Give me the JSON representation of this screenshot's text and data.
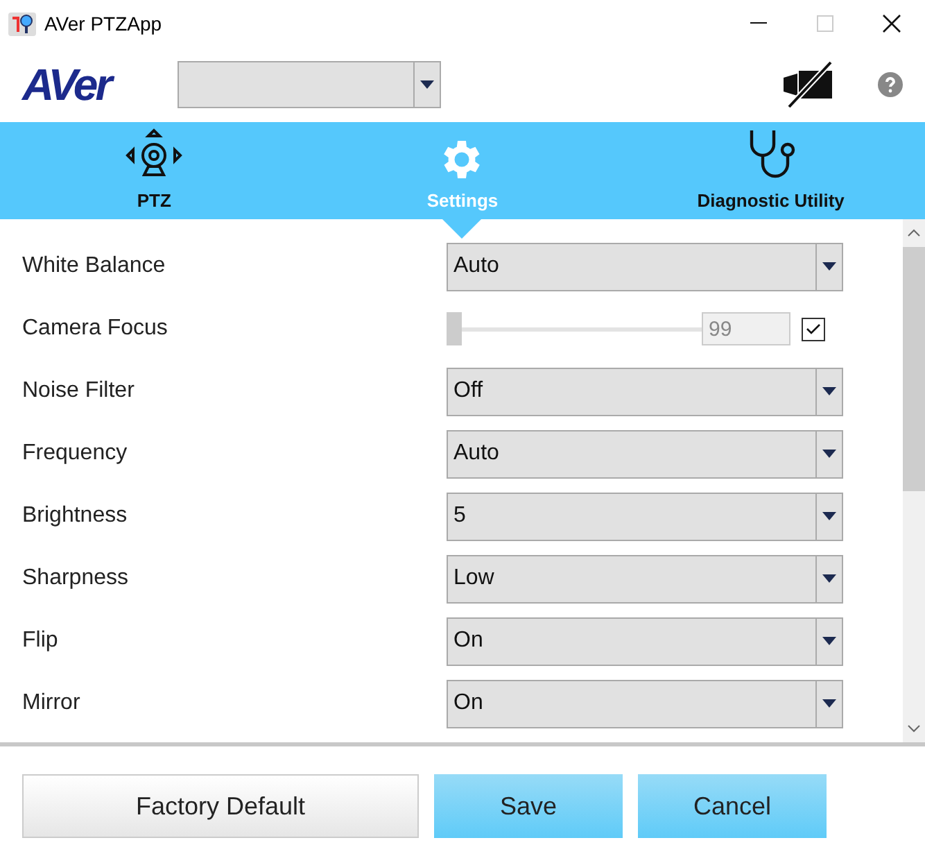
{
  "window": {
    "title": "AVer PTZApp"
  },
  "header": {
    "logo": "AVer",
    "camera_select": {
      "kind": "dropdown"
    }
  },
  "tabs": [
    {
      "label": "PTZ",
      "kind": "ptz",
      "selected": false
    },
    {
      "label": "Settings",
      "kind": "settings",
      "selected": true
    },
    {
      "label": "Diagnostic Utility",
      "kind": "diagnostic",
      "selected": false
    }
  ],
  "settings": [
    {
      "label": "White Balance",
      "kind": "dropdown",
      "value": "Auto"
    },
    {
      "label": "Camera Focus",
      "kind": "slider",
      "level": 0,
      "value": "99",
      "disabled": true,
      "checked": true
    },
    {
      "label": "Noise Filter",
      "kind": "dropdown",
      "value": "Off"
    },
    {
      "label": "Frequency",
      "kind": "dropdown",
      "value": "Auto"
    },
    {
      "label": "Brightness",
      "kind": "dropdown",
      "value": "5"
    },
    {
      "label": "Sharpness",
      "kind": "dropdown",
      "value": "Low"
    },
    {
      "label": "Flip",
      "kind": "dropdown",
      "value": "On"
    },
    {
      "label": "Mirror",
      "kind": "dropdown",
      "value": "On"
    }
  ],
  "buttons": [
    {
      "label": "Factory Default",
      "kind": "plain"
    },
    {
      "label": "Save",
      "kind": "primary"
    },
    {
      "label": "Cancel",
      "kind": "primary"
    }
  ]
}
